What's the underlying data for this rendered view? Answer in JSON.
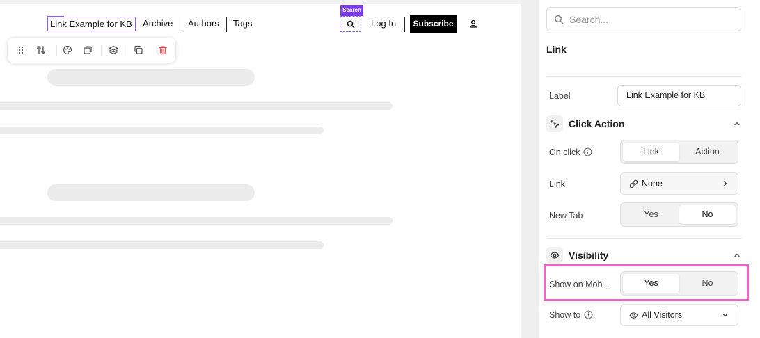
{
  "nav": {
    "selected_link": "Link Example for KB",
    "links": [
      "Archive",
      "Authors",
      "Tags"
    ],
    "search_tag": "Search",
    "login": "Log In",
    "subscribe": "Subscribe"
  },
  "toolbar": {
    "icons": [
      "drag-handle-icon",
      "reorder-icon",
      "palette-icon",
      "duplicate-frame-icon",
      "layers-icon",
      "copy-icon",
      "delete-icon"
    ]
  },
  "panel": {
    "search_placeholder": "Search...",
    "title": "Link",
    "label_field": {
      "label": "Label",
      "value": "Link Example for KB"
    },
    "click_action": {
      "title": "Click Action",
      "on_click": {
        "label": "On click",
        "options": [
          "Link",
          "Action"
        ],
        "selected": "Link"
      },
      "link": {
        "label": "Link",
        "value": "None"
      },
      "new_tab": {
        "label": "New Tab",
        "options": [
          "Yes",
          "No"
        ],
        "selected": "No"
      }
    },
    "visibility": {
      "title": "Visibility",
      "show_on_mobile": {
        "label": "Show on Mob...",
        "options": [
          "Yes",
          "No"
        ],
        "selected": "Yes"
      },
      "show_to": {
        "label": "Show to",
        "value": "All Visitors"
      }
    }
  },
  "colors": {
    "accent": "#7c3aed",
    "highlight": "#f062c8",
    "delete": "#e5484d"
  }
}
